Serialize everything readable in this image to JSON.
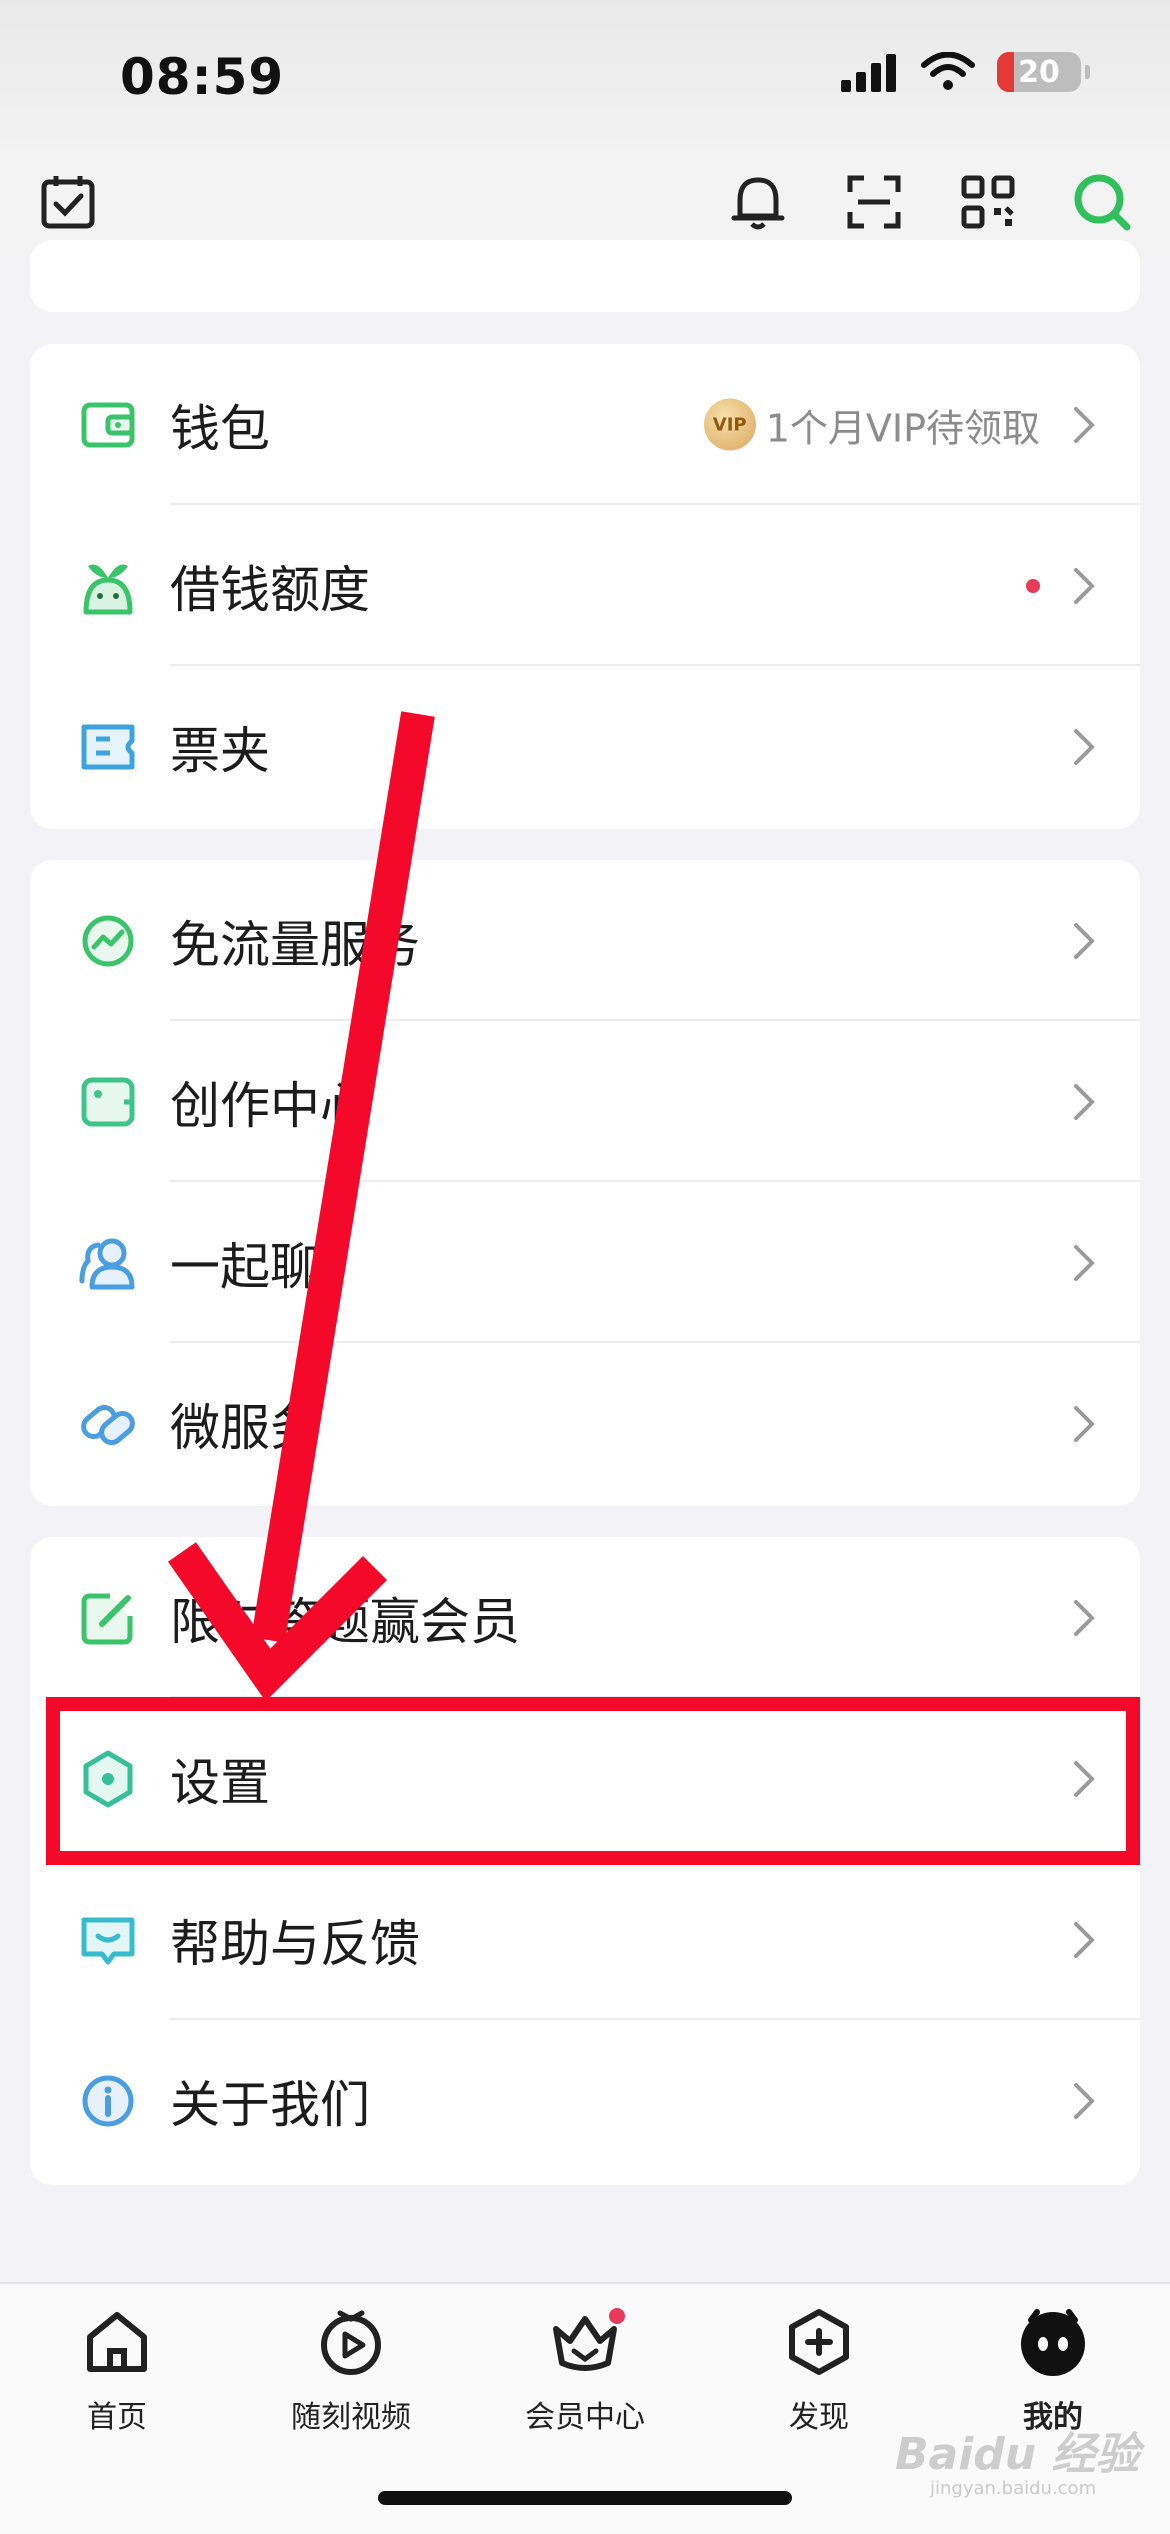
{
  "status_bar": {
    "time": "08:59",
    "battery": "20",
    "battery_level_pct": 20
  },
  "top_bar": {
    "icons": [
      "calendar-check-icon",
      "bell-icon",
      "scan-icon",
      "qrcode-icon",
      "search-icon"
    ]
  },
  "groups": [
    {
      "items": [
        {
          "label": "钱包",
          "icon": "wallet-icon",
          "note": "1个月VIP待领取",
          "badge": "VIP"
        },
        {
          "label": "借钱额度",
          "icon": "sprout-icon",
          "red_dot": true
        },
        {
          "label": "票夹",
          "icon": "ticket-icon"
        }
      ]
    },
    {
      "items": [
        {
          "label": "免流量服务",
          "icon": "pulse-icon"
        },
        {
          "label": "创作中心",
          "icon": "creator-icon"
        },
        {
          "label": "一起聊",
          "icon": "chat-people-icon"
        },
        {
          "label": "微服务",
          "icon": "link-icon"
        }
      ]
    },
    {
      "items": [
        {
          "label": "限时答题赢会员",
          "icon": "edit-icon"
        },
        {
          "label": "设置",
          "icon": "settings-hexagon-icon"
        },
        {
          "label": "帮助与反馈",
          "icon": "help-icon"
        },
        {
          "label": "关于我们",
          "icon": "info-icon"
        }
      ]
    }
  ],
  "tabbar": [
    {
      "label": "首页",
      "icon": "home-icon"
    },
    {
      "label": "随刻视频",
      "icon": "video-play-icon"
    },
    {
      "label": "会员中心",
      "icon": "crown-basket-icon",
      "dot": true
    },
    {
      "label": "发现",
      "icon": "discover-plus-icon"
    },
    {
      "label": "我的",
      "icon": "mine-avatar-icon",
      "active": true
    }
  ],
  "watermark": {
    "text": "Baidu 经验",
    "sub": "jingyan.baidu.com"
  },
  "colors": {
    "accent": "#2fbf5b",
    "highlight": "#f5092a",
    "red_dot": "#e83b5a"
  }
}
